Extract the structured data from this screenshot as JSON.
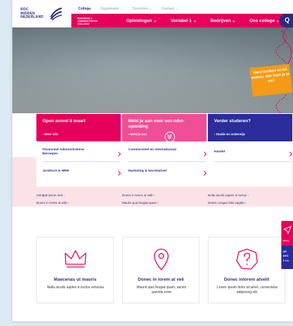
{
  "logo": {
    "line1": "ROC",
    "line2": "MIDDEN",
    "line3": "NEDERLAND"
  },
  "topnav": [
    "Collega",
    "Organisatie ⌄",
    "Docenten ⌄",
    "Contact ⌄"
  ],
  "mainbar": {
    "sub1": "BUSINESS &",
    "sub2": "ADMINISTRATIVE",
    "sub3": "COLLEGE",
    "items": [
      "Opleidingen ⌄",
      "Voriabel 1 ⌄",
      "Bedrijven ⌄",
      "Ons college ⌄"
    ],
    "search": "Q"
  },
  "hero": {
    "quote": "Hard werken én lol maken, dan kom je er wel"
  },
  "tiles": [
    {
      "title": "Open avond 8 maart",
      "link": "› Meer info"
    },
    {
      "title": "Meld je aan voor een mbo-opleiding",
      "link": "› Meld je aan"
    },
    {
      "title": "Verder studeren?",
      "link": "› Studie en onderwijs"
    }
  ],
  "courses": [
    "Financieel Administratieve Beroepen",
    "Commercieel en internationaal",
    "Handel",
    "Juridisch & HRM",
    "Marketing & Secretarieel"
  ],
  "links": [
    "Volutpat ipsum sed ›",
    "Donec in lorem at velit ›",
    "Donec in lorem at velit ›",
    "Mauris quis feugiat quam ›",
    "Nulla iaculis sapien in luctus ›",
    "Donec congue felis sagittis ›"
  ],
  "cards": [
    {
      "title": "Maecenas ut mauris",
      "text": "Nulla iaculis sapien in luctus vehicula.",
      "icon": "crown-icon"
    },
    {
      "title": "Donec in lorem at veli",
      "text": "Mauris quis feugiat quam, auctor gravida enim",
      "icon": "location-pin-icon"
    },
    {
      "title": "Donec inlorem atvelit",
      "text": "Lorem ipsum dolor sit amet, consectetur adipiscing elit.",
      "icon": "question-icon"
    }
  ],
  "side": {
    "meld": "Meld j",
    "open1": "OP",
    "open2": "AVO",
    "open3": "8 Ma"
  },
  "colors": {
    "brand_pink": "#e5005b",
    "brand_blue": "#2a2d9b",
    "accent_orange": "#f49a16"
  }
}
